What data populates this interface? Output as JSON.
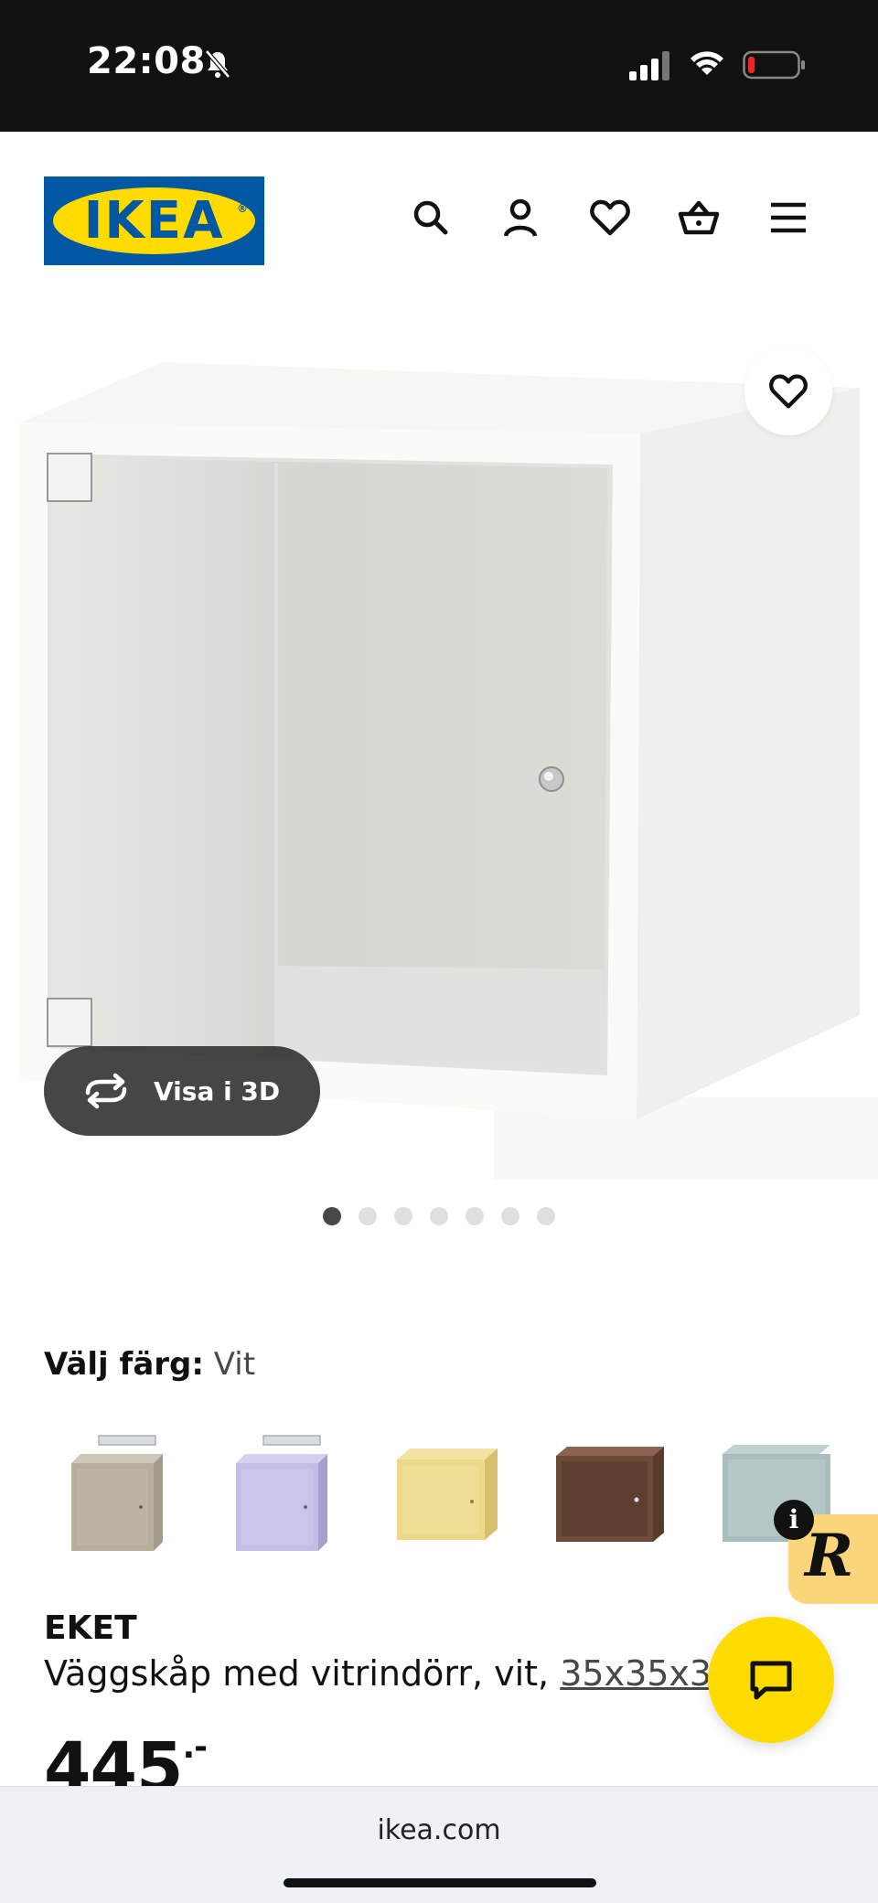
{
  "status_bar": {
    "time": "22:08"
  },
  "header": {
    "logo_text": "IKEA",
    "icons": [
      "search-icon",
      "account-icon",
      "heart-icon",
      "basket-icon",
      "menu-icon"
    ]
  },
  "gallery": {
    "view3d_label": "Visa i 3D",
    "dot_count": 7,
    "active_dot": 1
  },
  "color_picker": {
    "label": "Välj färg:",
    "selected": "Vit",
    "swatches": [
      {
        "color": "#b7ad9b"
      },
      {
        "color": "#c4bde4"
      },
      {
        "color": "#ecd989"
      },
      {
        "color": "#6e4b38"
      },
      {
        "color": "#a9bdbd"
      }
    ]
  },
  "product": {
    "name": "EKET",
    "description": "Väggskåp med vitrindörr, vit,",
    "dimensions": "35x35x35 cm",
    "price": "445",
    "price_suffix": ".-"
  },
  "browser": {
    "url": "ikea.com"
  },
  "colors": {
    "ikea_blue": "#0058a3",
    "ikea_yellow": "#ffdb00",
    "r_badge": "#fbd57c"
  }
}
